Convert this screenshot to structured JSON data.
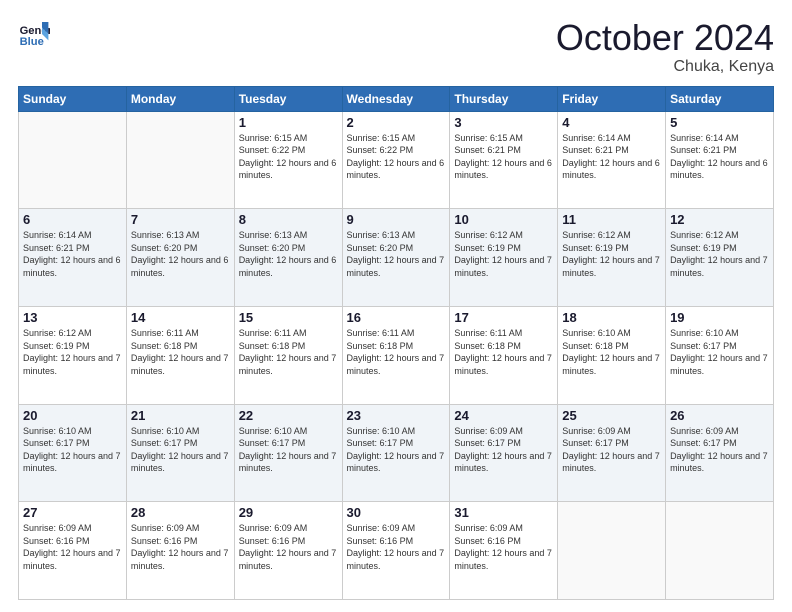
{
  "logo": {
    "line1": "General",
    "line2": "Blue"
  },
  "header": {
    "month": "October 2024",
    "location": "Chuka, Kenya"
  },
  "days_of_week": [
    "Sunday",
    "Monday",
    "Tuesday",
    "Wednesday",
    "Thursday",
    "Friday",
    "Saturday"
  ],
  "weeks": [
    {
      "shade": "white",
      "days": [
        {
          "num": "",
          "info": ""
        },
        {
          "num": "",
          "info": ""
        },
        {
          "num": "1",
          "info": "Sunrise: 6:15 AM\nSunset: 6:22 PM\nDaylight: 12 hours\nand 6 minutes."
        },
        {
          "num": "2",
          "info": "Sunrise: 6:15 AM\nSunset: 6:22 PM\nDaylight: 12 hours\nand 6 minutes."
        },
        {
          "num": "3",
          "info": "Sunrise: 6:15 AM\nSunset: 6:21 PM\nDaylight: 12 hours\nand 6 minutes."
        },
        {
          "num": "4",
          "info": "Sunrise: 6:14 AM\nSunset: 6:21 PM\nDaylight: 12 hours\nand 6 minutes."
        },
        {
          "num": "5",
          "info": "Sunrise: 6:14 AM\nSunset: 6:21 PM\nDaylight: 12 hours\nand 6 minutes."
        }
      ]
    },
    {
      "shade": "shaded",
      "days": [
        {
          "num": "6",
          "info": "Sunrise: 6:14 AM\nSunset: 6:21 PM\nDaylight: 12 hours\nand 6 minutes."
        },
        {
          "num": "7",
          "info": "Sunrise: 6:13 AM\nSunset: 6:20 PM\nDaylight: 12 hours\nand 6 minutes."
        },
        {
          "num": "8",
          "info": "Sunrise: 6:13 AM\nSunset: 6:20 PM\nDaylight: 12 hours\nand 6 minutes."
        },
        {
          "num": "9",
          "info": "Sunrise: 6:13 AM\nSunset: 6:20 PM\nDaylight: 12 hours\nand 7 minutes."
        },
        {
          "num": "10",
          "info": "Sunrise: 6:12 AM\nSunset: 6:19 PM\nDaylight: 12 hours\nand 7 minutes."
        },
        {
          "num": "11",
          "info": "Sunrise: 6:12 AM\nSunset: 6:19 PM\nDaylight: 12 hours\nand 7 minutes."
        },
        {
          "num": "12",
          "info": "Sunrise: 6:12 AM\nSunset: 6:19 PM\nDaylight: 12 hours\nand 7 minutes."
        }
      ]
    },
    {
      "shade": "white",
      "days": [
        {
          "num": "13",
          "info": "Sunrise: 6:12 AM\nSunset: 6:19 PM\nDaylight: 12 hours\nand 7 minutes."
        },
        {
          "num": "14",
          "info": "Sunrise: 6:11 AM\nSunset: 6:18 PM\nDaylight: 12 hours\nand 7 minutes."
        },
        {
          "num": "15",
          "info": "Sunrise: 6:11 AM\nSunset: 6:18 PM\nDaylight: 12 hours\nand 7 minutes."
        },
        {
          "num": "16",
          "info": "Sunrise: 6:11 AM\nSunset: 6:18 PM\nDaylight: 12 hours\nand 7 minutes."
        },
        {
          "num": "17",
          "info": "Sunrise: 6:11 AM\nSunset: 6:18 PM\nDaylight: 12 hours\nand 7 minutes."
        },
        {
          "num": "18",
          "info": "Sunrise: 6:10 AM\nSunset: 6:18 PM\nDaylight: 12 hours\nand 7 minutes."
        },
        {
          "num": "19",
          "info": "Sunrise: 6:10 AM\nSunset: 6:17 PM\nDaylight: 12 hours\nand 7 minutes."
        }
      ]
    },
    {
      "shade": "shaded",
      "days": [
        {
          "num": "20",
          "info": "Sunrise: 6:10 AM\nSunset: 6:17 PM\nDaylight: 12 hours\nand 7 minutes."
        },
        {
          "num": "21",
          "info": "Sunrise: 6:10 AM\nSunset: 6:17 PM\nDaylight: 12 hours\nand 7 minutes."
        },
        {
          "num": "22",
          "info": "Sunrise: 6:10 AM\nSunset: 6:17 PM\nDaylight: 12 hours\nand 7 minutes."
        },
        {
          "num": "23",
          "info": "Sunrise: 6:10 AM\nSunset: 6:17 PM\nDaylight: 12 hours\nand 7 minutes."
        },
        {
          "num": "24",
          "info": "Sunrise: 6:09 AM\nSunset: 6:17 PM\nDaylight: 12 hours\nand 7 minutes."
        },
        {
          "num": "25",
          "info": "Sunrise: 6:09 AM\nSunset: 6:17 PM\nDaylight: 12 hours\nand 7 minutes."
        },
        {
          "num": "26",
          "info": "Sunrise: 6:09 AM\nSunset: 6:17 PM\nDaylight: 12 hours\nand 7 minutes."
        }
      ]
    },
    {
      "shade": "white",
      "days": [
        {
          "num": "27",
          "info": "Sunrise: 6:09 AM\nSunset: 6:16 PM\nDaylight: 12 hours\nand 7 minutes."
        },
        {
          "num": "28",
          "info": "Sunrise: 6:09 AM\nSunset: 6:16 PM\nDaylight: 12 hours\nand 7 minutes."
        },
        {
          "num": "29",
          "info": "Sunrise: 6:09 AM\nSunset: 6:16 PM\nDaylight: 12 hours\nand 7 minutes."
        },
        {
          "num": "30",
          "info": "Sunrise: 6:09 AM\nSunset: 6:16 PM\nDaylight: 12 hours\nand 7 minutes."
        },
        {
          "num": "31",
          "info": "Sunrise: 6:09 AM\nSunset: 6:16 PM\nDaylight: 12 hours\nand 7 minutes."
        },
        {
          "num": "",
          "info": ""
        },
        {
          "num": "",
          "info": ""
        }
      ]
    }
  ]
}
